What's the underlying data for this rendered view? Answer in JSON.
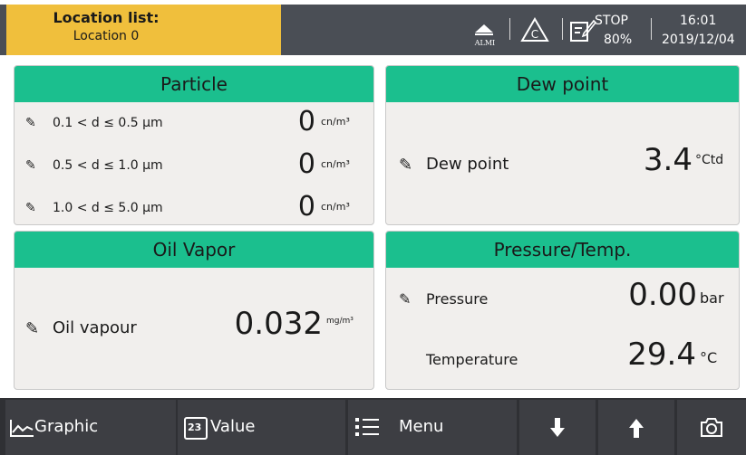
{
  "header": {
    "location_title": "Location list:",
    "location_value": "Location 0",
    "almi_label": "ALMI",
    "alarm_icon": "triangle-c-icon",
    "record_state": "STOP",
    "record_percent": "80%",
    "time": "16:01",
    "date": "2019/12/04"
  },
  "panels": {
    "particle": {
      "title": "Particle",
      "rows": [
        {
          "label": "0.1 < d ≤ 0.5 µm",
          "value": "0",
          "unit": "cn/m³"
        },
        {
          "label": "0.5 < d ≤ 1.0 µm",
          "value": "0",
          "unit": "cn/m³"
        },
        {
          "label": "1.0 < d ≤ 5.0 µm",
          "value": "0",
          "unit": "cn/m³"
        }
      ]
    },
    "dewpoint": {
      "title": "Dew point",
      "label": "Dew point",
      "value": "3.4",
      "unit": "°Ctd"
    },
    "oil": {
      "title": "Oil Vapor",
      "label": "Oil vapour",
      "value": "0.032",
      "unit": "mg/m³"
    },
    "pressure": {
      "title": "Pressure/Temp.",
      "pressure_label": "Pressure",
      "pressure_value": "0.00",
      "pressure_unit": "bar",
      "temp_label": "Temperature",
      "temp_value": "29.4",
      "temp_unit": "°C"
    }
  },
  "nav": {
    "graphic": "Graphic",
    "value_icon_text": "23",
    "value": "Value",
    "menu": "Menu"
  },
  "colors": {
    "accent_green": "#1bbf8e",
    "location_yellow": "#f0bf3c",
    "topbar": "#4a4e55",
    "navbar": "#3d3e43"
  }
}
